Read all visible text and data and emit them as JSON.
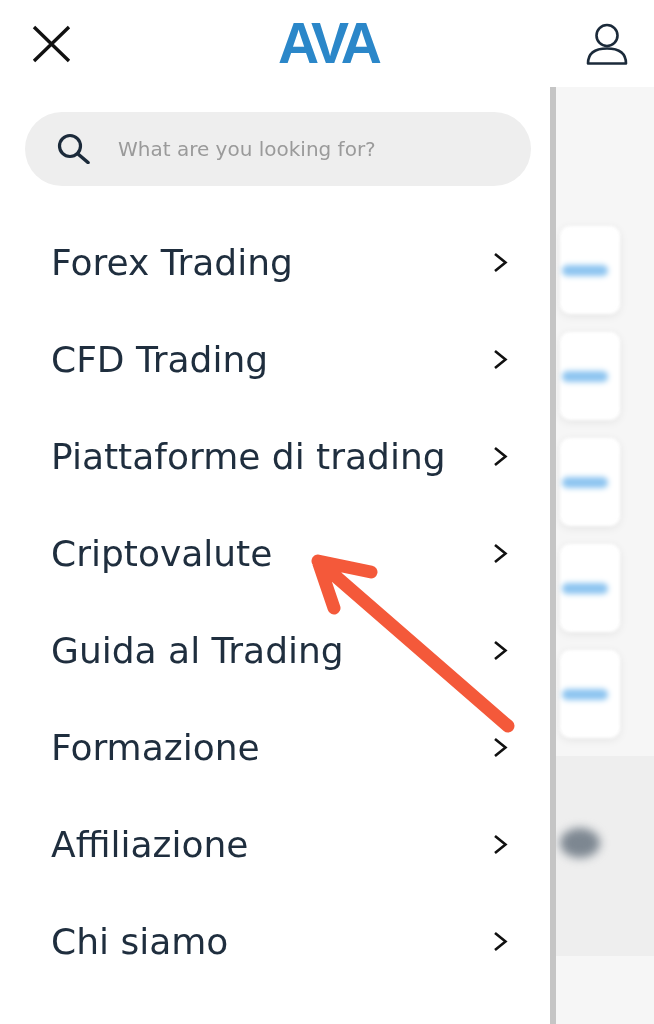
{
  "header": {
    "logo": "AVA"
  },
  "search": {
    "placeholder": "What are you looking for?"
  },
  "menu": {
    "items": [
      {
        "label": "Forex Trading"
      },
      {
        "label": "CFD Trading"
      },
      {
        "label": "Piattaforme di trading"
      },
      {
        "label": "Criptovalute"
      },
      {
        "label": "Guida al Trading"
      },
      {
        "label": "Formazione"
      },
      {
        "label": "Affiliazione"
      },
      {
        "label": "Chi siamo"
      }
    ]
  }
}
